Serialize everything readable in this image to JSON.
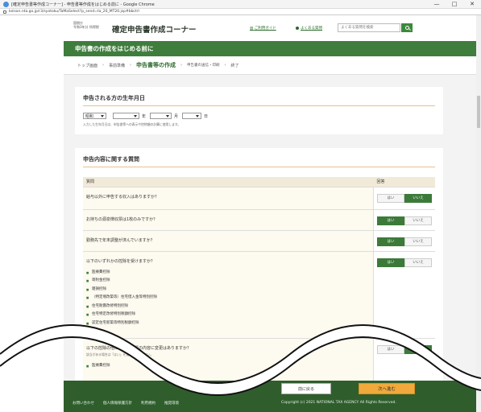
{
  "browser": {
    "window_title": "[確定申告書等作成コーナー] - 申告書等作成をはじめる前に - Google Chrome",
    "url": "keisan.nta.go.jp/r3/syotoku/TaMaSelect?p_send=ta_20_MT20.jsp#bbctrl",
    "controls": [
      "—",
      "□",
      "✕"
    ]
  },
  "header": {
    "agency_line1": "国税庁",
    "agency_line2": "令和3年分  所得税",
    "title": "確定申告書作成コーナー",
    "guide_link": "ご利用ガイド",
    "faq_link": "よくある質問",
    "search_placeholder": "よくある質問を検索"
  },
  "green_bar_title": "申告書の作成をはじめる前に",
  "steps": [
    {
      "label": "トップ画面"
    },
    {
      "label": "事前準備"
    },
    {
      "label": "申告書等の作成"
    },
    {
      "label": "申告書の送信・印刷"
    },
    {
      "label": "終了"
    }
  ],
  "dob": {
    "heading": "申告される方の生年月日",
    "era": "昭和",
    "year": "",
    "year_unit": "年",
    "month": "",
    "month_unit": "月",
    "day": "",
    "day_unit": "日",
    "note": "入力した生年月日は、申告書等への表示や控除額の計算に使用します。"
  },
  "questions": {
    "heading": "申告内容に関する質問",
    "col_question": "質問",
    "col_answer": "回答",
    "yes": "はい",
    "no": "いいえ",
    "rows": [
      {
        "text": "給与以外に申告する収入はありますか？"
      },
      {
        "text": "お持ちの源泉徴収票は1枚のみですか？"
      },
      {
        "text": "勤務先で年末調整が済んでいますか？"
      },
      {
        "text": "以下のいずれかの控除を受けますか？",
        "items": [
          "医療費控除",
          "寄附金控除",
          "雑損控除",
          "（特定増改築等）住宅借入金等特別控除",
          "住宅耐震改修特別控除",
          "住宅特定改修特別税額控除",
          "認定住宅新築等特別税額控除"
        ]
      },
      {
        "text": "以下の控除の他に源泉徴収票の内容に変更はありますか？",
        "sub": "該当がある場合は「はい」を選択してください。",
        "items": [
          "医療費控除"
        ]
      }
    ]
  },
  "footer": {
    "back": "前に戻る",
    "next": "次へ進む",
    "links": [
      "お問い合わせ",
      "個人情報保護方針",
      "利用規約",
      "推奨環境"
    ],
    "copyright": "Copyright (c) 2021 NATIONAL TAX AGENCY All Rights Reserved."
  },
  "colors": {
    "brand_green": "#3f7d3c",
    "footer_green": "#2f5e2c",
    "next_button": "#f0a93a",
    "table_header": "#f2ead8"
  }
}
